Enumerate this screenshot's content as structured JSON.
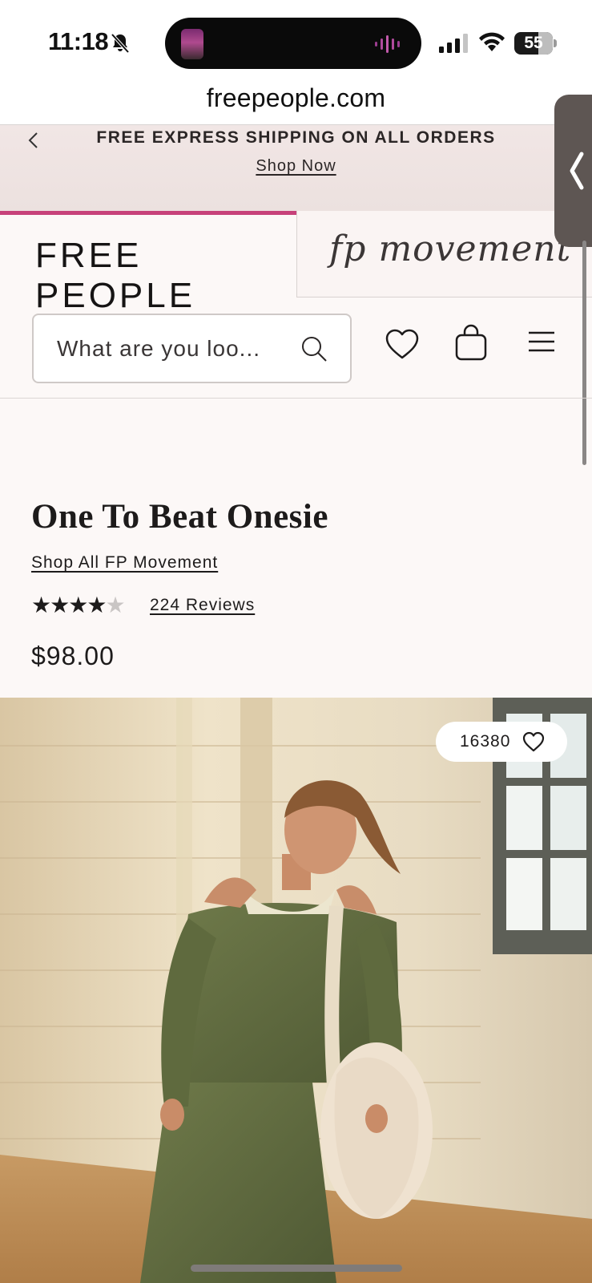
{
  "status_bar": {
    "time": "11:18",
    "battery": "55",
    "icons": [
      "bell-slash-icon",
      "cellular-signal-icon",
      "wifi-icon",
      "battery-icon"
    ]
  },
  "browser": {
    "url": "freepeople.com"
  },
  "promo": {
    "prev_icon": "chevron-left-icon",
    "message": "FREE EXPRESS SHIPPING ON ALL ORDERS",
    "link": "Shop Now"
  },
  "brand_tabs": {
    "free_people": "FREE PEOPLE",
    "fp_movement": "fp movement",
    "active": "free_people"
  },
  "header": {
    "search_placeholder": "What are you loo...",
    "search_icon": "search-icon",
    "wishlist_icon": "heart-icon",
    "bag_icon": "bag-icon",
    "menu_icon": "menu-icon"
  },
  "product": {
    "title": "One To Beat Onesie",
    "collection_link": "Shop All FP Movement",
    "rating": 4,
    "rating_max": 5,
    "reviews": "224 Reviews",
    "price": "$98.00",
    "favorites": "16380"
  },
  "colors": {
    "accent": "#c7417a",
    "promo_bg": "#efe4e3",
    "page_bg": "#fcf8f7"
  }
}
